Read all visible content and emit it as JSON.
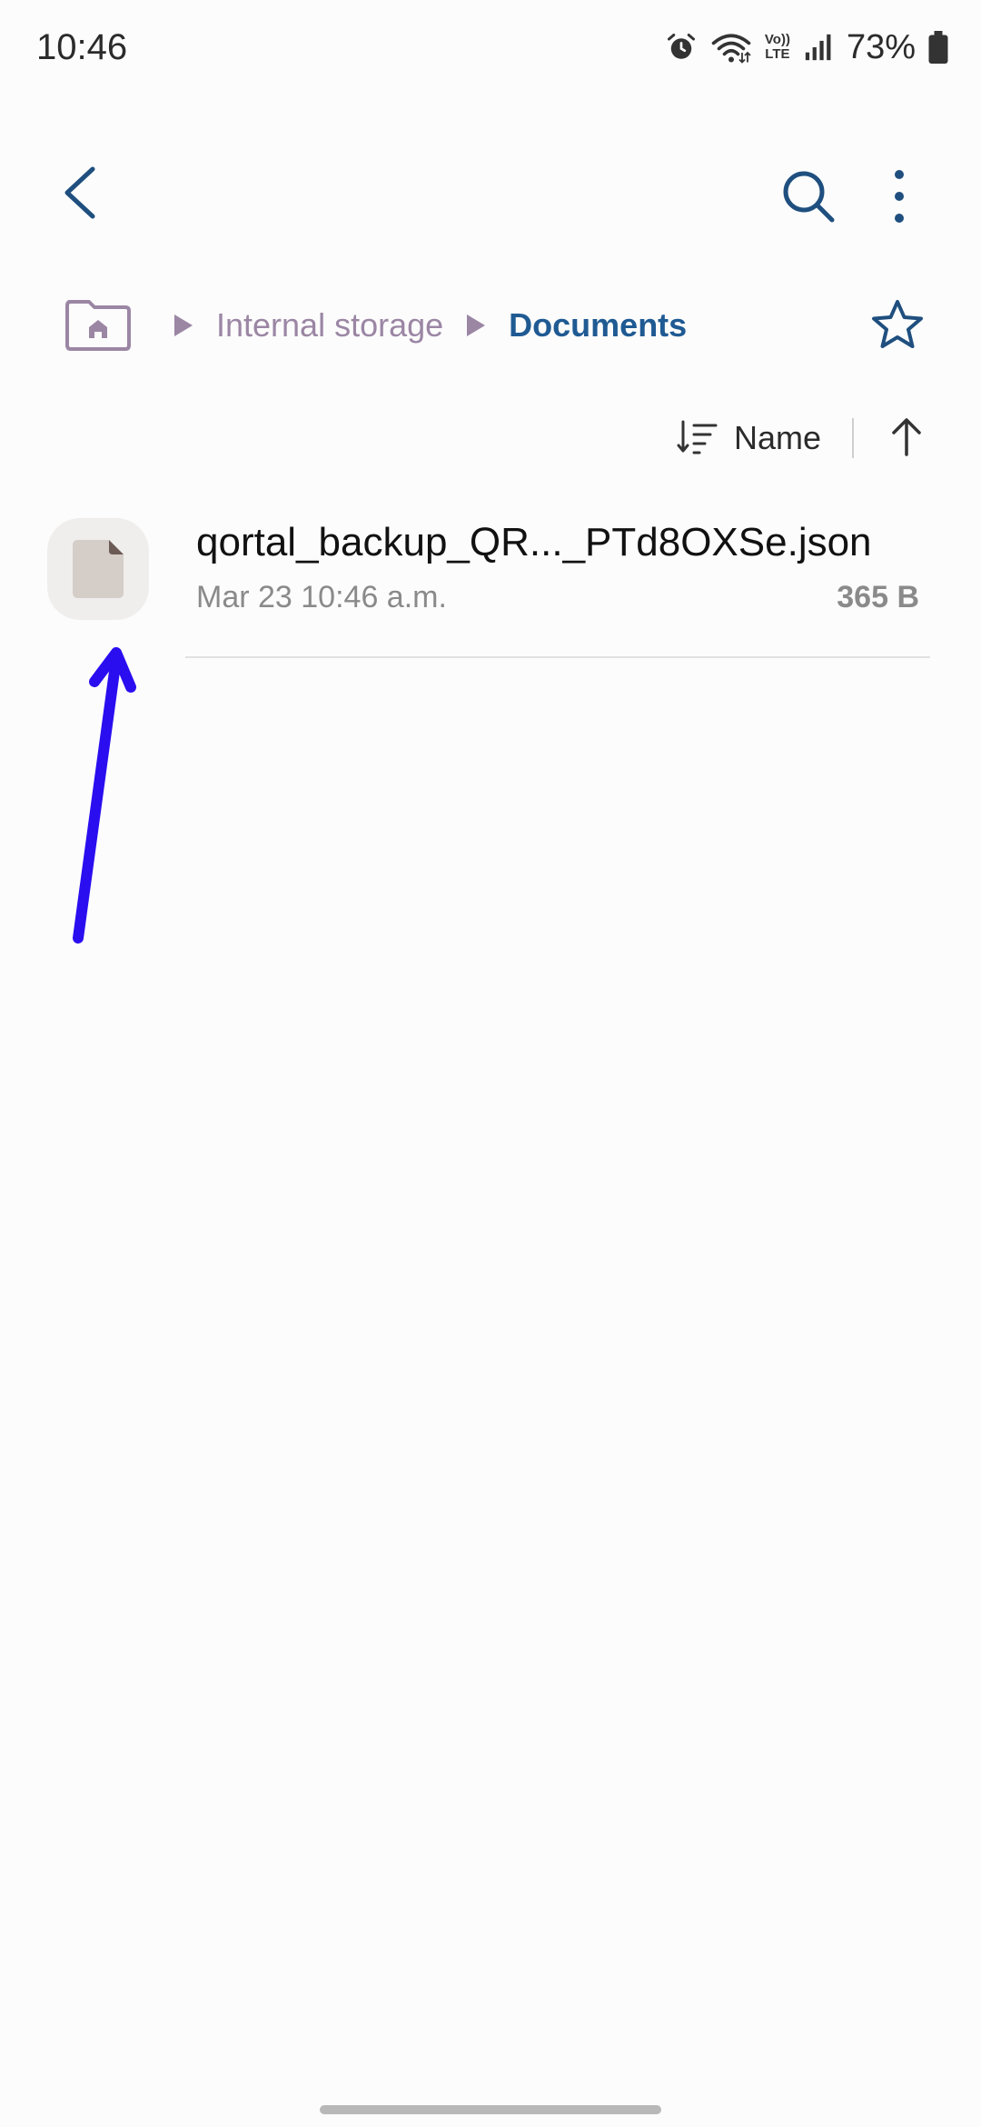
{
  "status_bar": {
    "time": "10:46",
    "battery": "73%",
    "volte_label_top": "Vo))",
    "volte_label_bottom": "LTE"
  },
  "app_bar": {
    "back_icon": "chevron-left-icon",
    "search_icon": "search-icon",
    "more_icon": "more-vert-icon"
  },
  "breadcrumb": {
    "home_icon": "folder-home-icon",
    "items": [
      "Internal storage",
      "Documents"
    ]
  },
  "sort": {
    "label": "Name",
    "direction": "ascending"
  },
  "files": [
    {
      "name": "qortal_backup_QR..._PTd8OXSe.json",
      "date": "Mar 23 10:46 a.m.",
      "size": "365 B"
    }
  ],
  "colors": {
    "accent": "#1f5a93",
    "breadcrumb_muted": "#9b86a4",
    "annotation_arrow": "#2a0ef0",
    "file_icon": "#d4cdc8",
    "file_icon_fold": "#6b5a55"
  }
}
